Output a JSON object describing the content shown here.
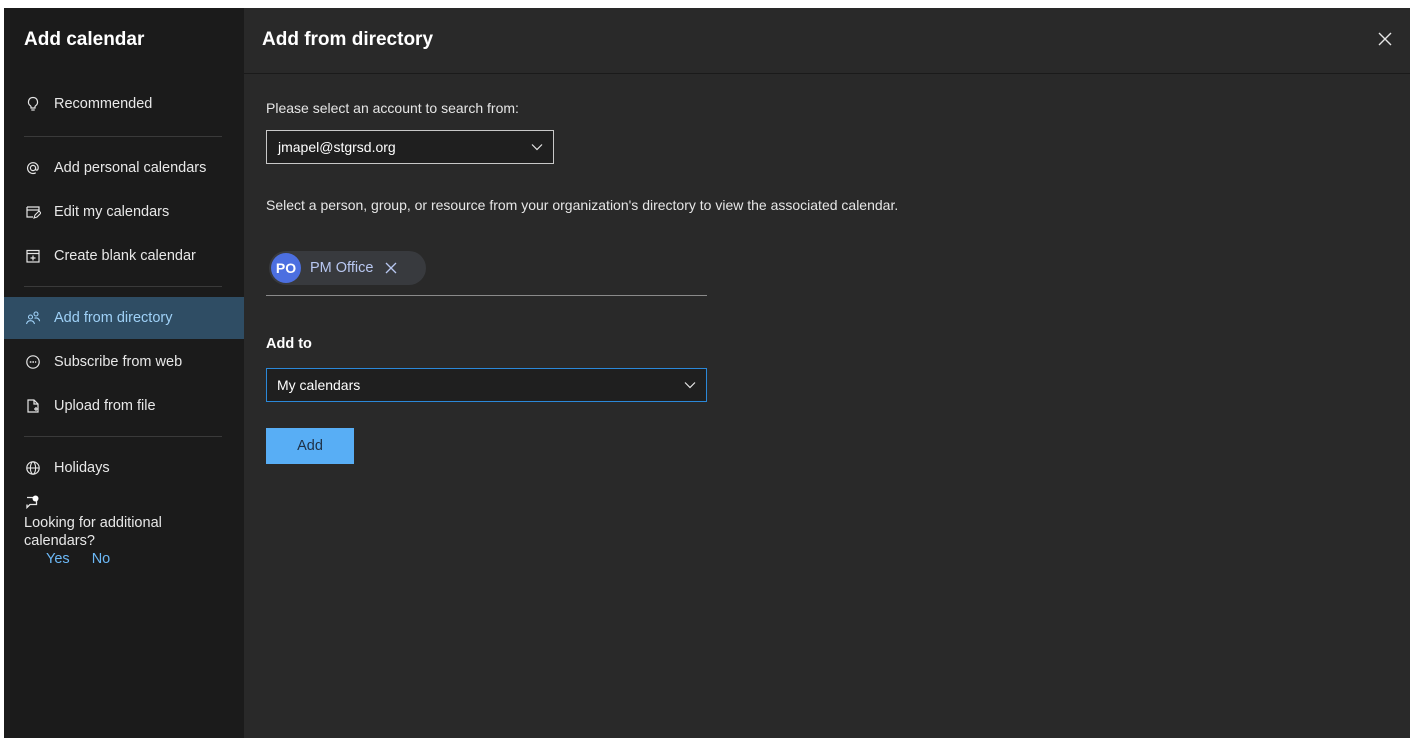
{
  "sidebar": {
    "title": "Add calendar",
    "items": [
      {
        "label": "Recommended",
        "icon": "lightbulb-icon"
      },
      {
        "label": "Add personal calendars",
        "icon": "at-sign-icon"
      },
      {
        "label": "Edit my calendars",
        "icon": "edit-calendar-icon"
      },
      {
        "label": "Create blank calendar",
        "icon": "calendar-add-icon"
      },
      {
        "label": "Add from directory",
        "icon": "people-search-icon",
        "active": true
      },
      {
        "label": "Subscribe from web",
        "icon": "link-circle-icon"
      },
      {
        "label": "Upload from file",
        "icon": "file-upload-icon"
      },
      {
        "label": "Holidays",
        "icon": "globe-icon"
      }
    ],
    "feedback": {
      "icon": "feedback-bubble-icon",
      "question": "Looking for additional calendars?",
      "yes": "Yes",
      "no": "No"
    }
  },
  "main": {
    "title": "Add from directory",
    "close_icon": "close-icon",
    "account_prompt": "Please select an account to search from:",
    "account_value": "jmapel@stgrsd.org",
    "directory_prompt": "Select a person, group, or resource from your organization's directory to view the associated calendar.",
    "chip": {
      "initials": "PO",
      "name": "PM Office",
      "avatar_color": "#4c6fe0"
    },
    "add_to_label": "Add to",
    "add_to_value": "My calendars",
    "add_button": "Add"
  },
  "colors": {
    "accent": "#58aef5",
    "active_nav_bg": "#2f4d64",
    "link": "#6cb8f6"
  }
}
